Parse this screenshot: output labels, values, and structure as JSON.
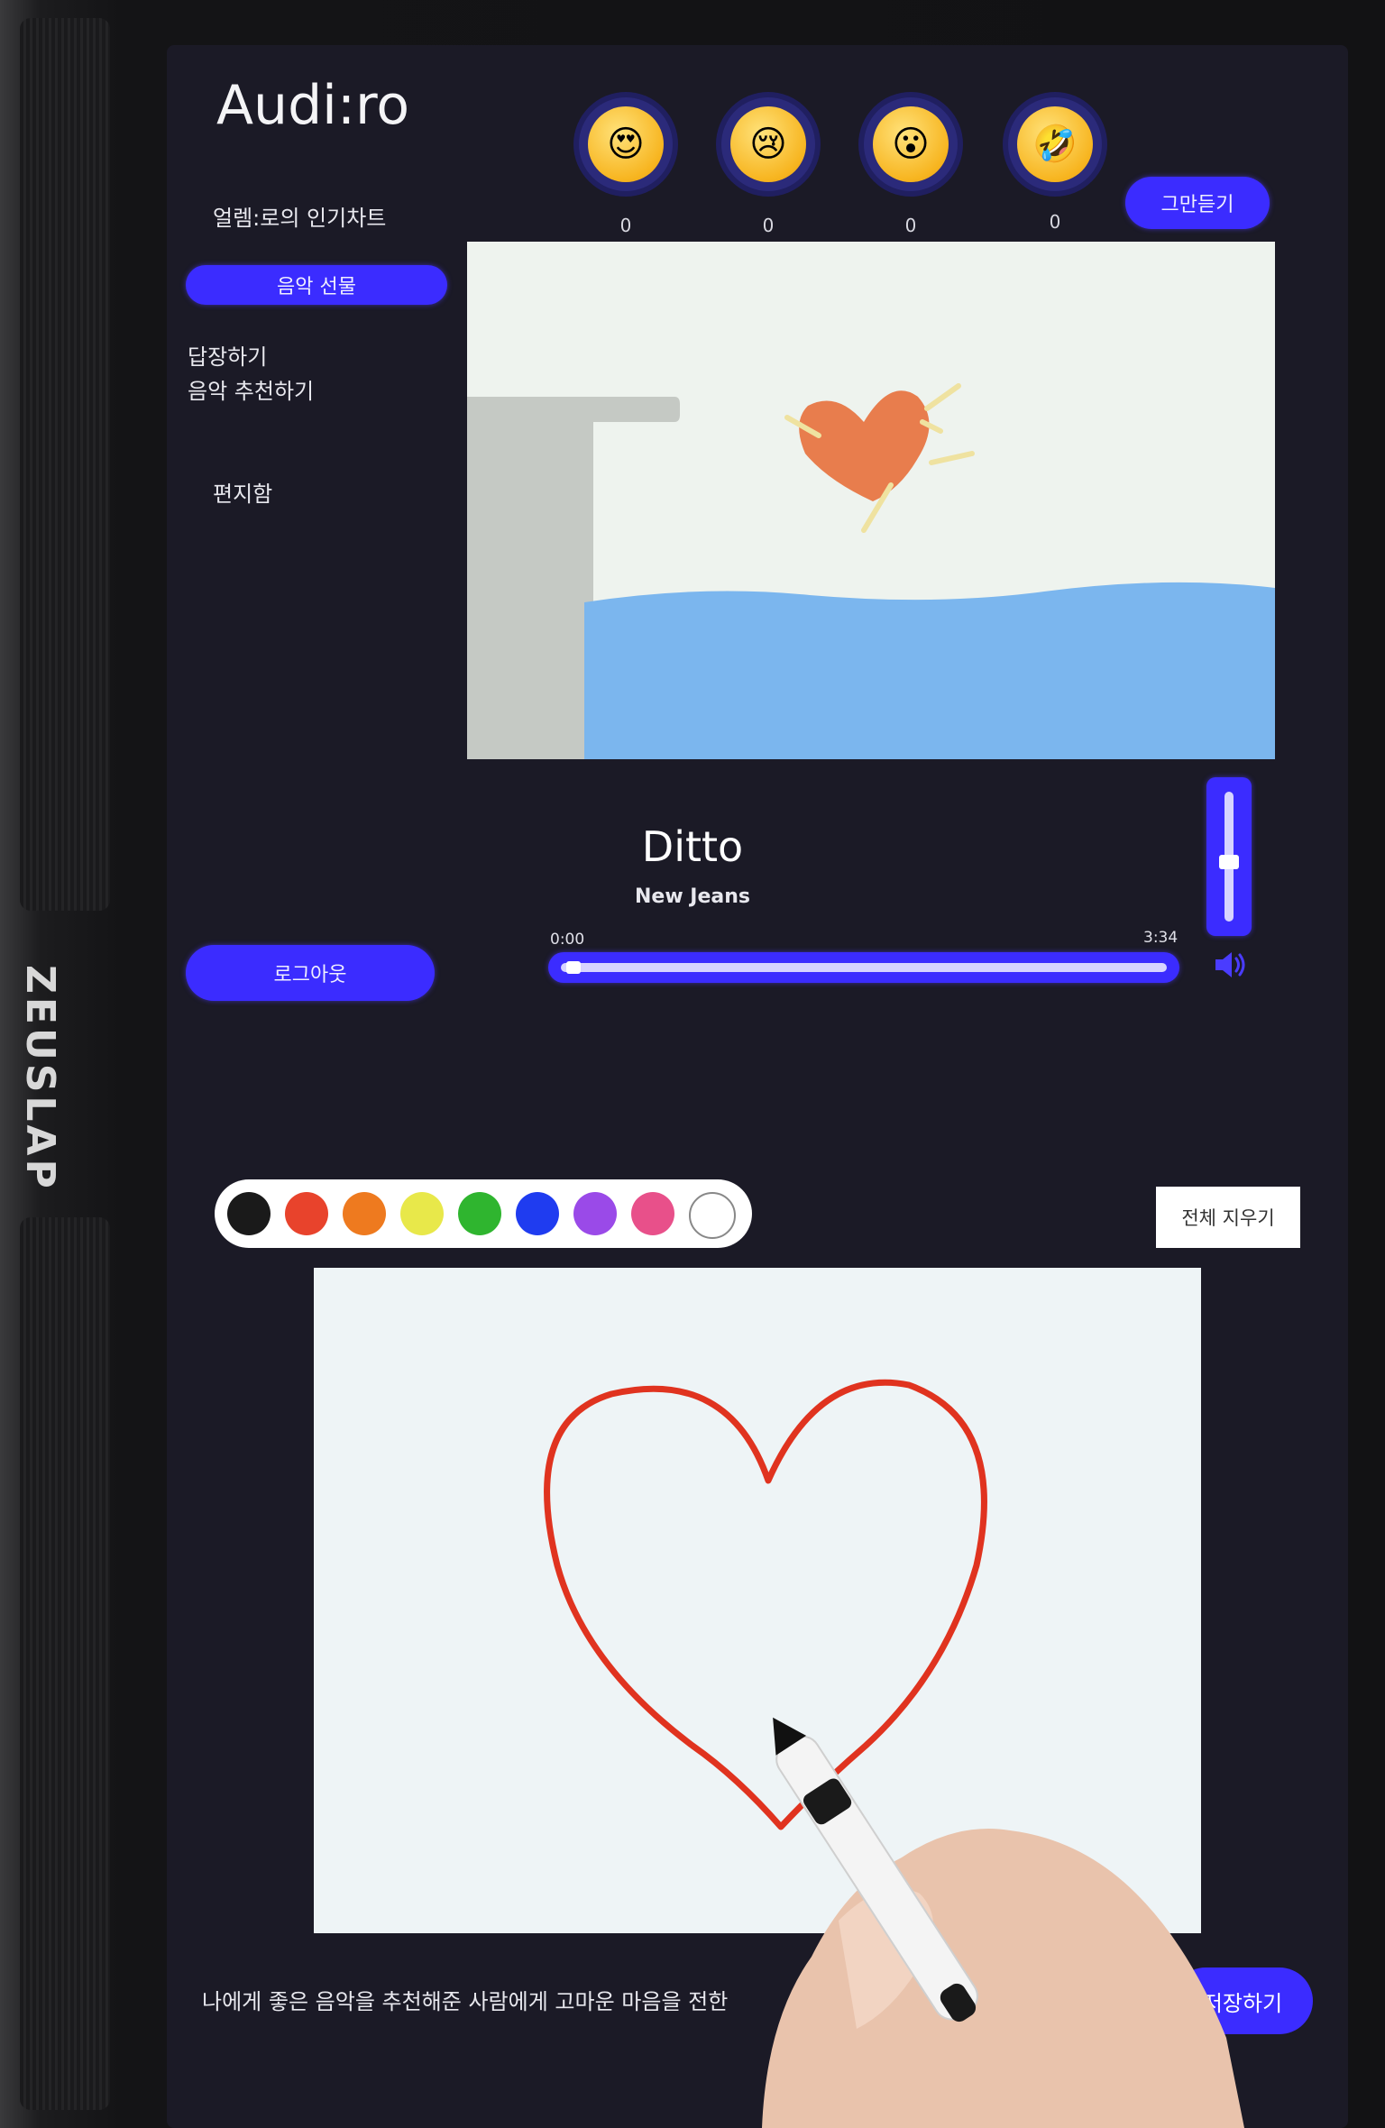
{
  "device": {
    "brand": "ZEUSLAP"
  },
  "app": {
    "logo": "Audi:ro"
  },
  "sidebar": {
    "chart_link": "얼렘:로의 인기차트",
    "active_item": "음악 선물",
    "reply_line1": "답장하기",
    "reply_line2": "음악 추천하기",
    "mailbox": "편지함",
    "logout": "로그아웃"
  },
  "reactions": [
    {
      "icon": "heart-eyes-emoji",
      "glyph": "😍",
      "count": "0"
    },
    {
      "icon": "crying-emoji",
      "glyph": "😢",
      "count": "0"
    },
    {
      "icon": "surprised-emoji",
      "glyph": "😮",
      "count": "0"
    },
    {
      "icon": "laughing-tears-emoji",
      "glyph": "🤣",
      "count": "0"
    }
  ],
  "stop_button": "그만듣기",
  "player": {
    "title": "Ditto",
    "artist": "New Jeans",
    "current_time": "0:00",
    "total_time": "3:34",
    "progress": 0.0,
    "volume": 0.45
  },
  "drawing": {
    "colors": [
      "#1a1a1a",
      "#e8432c",
      "#ee7a1f",
      "#e8e84a",
      "#2fb52f",
      "#1f3cf0",
      "#9a4ae8",
      "#e8508a",
      "#ffffff"
    ],
    "clear_all": "전체 지우기"
  },
  "footer": {
    "message": "나에게 좋은 음악을 추천해준 사람에게 고마운 마음을 전한",
    "save_button": "저장하기"
  },
  "colors": {
    "accent": "#3b2cff",
    "screen_bg": "#1b1a26"
  }
}
